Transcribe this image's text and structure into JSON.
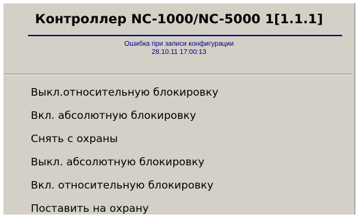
{
  "header": {
    "title": "Контроллер NC-1000/NC-5000 1[1.1.1]",
    "status_line_1": "Ошибка при записи конфигурации",
    "status_line_2": "28.10.11 17:00:13"
  },
  "menu": {
    "items": [
      {
        "label": "Выкл.относительную блокировку"
      },
      {
        "label": "Вкл. абсолютную блокировку"
      },
      {
        "label": "Снять с охраны"
      },
      {
        "label": "Выкл. абсолютную блокировку"
      },
      {
        "label": "Вкл. относительную блокировку"
      },
      {
        "label": "Поставить на охрану"
      }
    ]
  },
  "colors": {
    "panel_background": "#d4d0c8",
    "title_underline": "#000080",
    "status_text": "#000080",
    "menu_text": "#000000"
  }
}
